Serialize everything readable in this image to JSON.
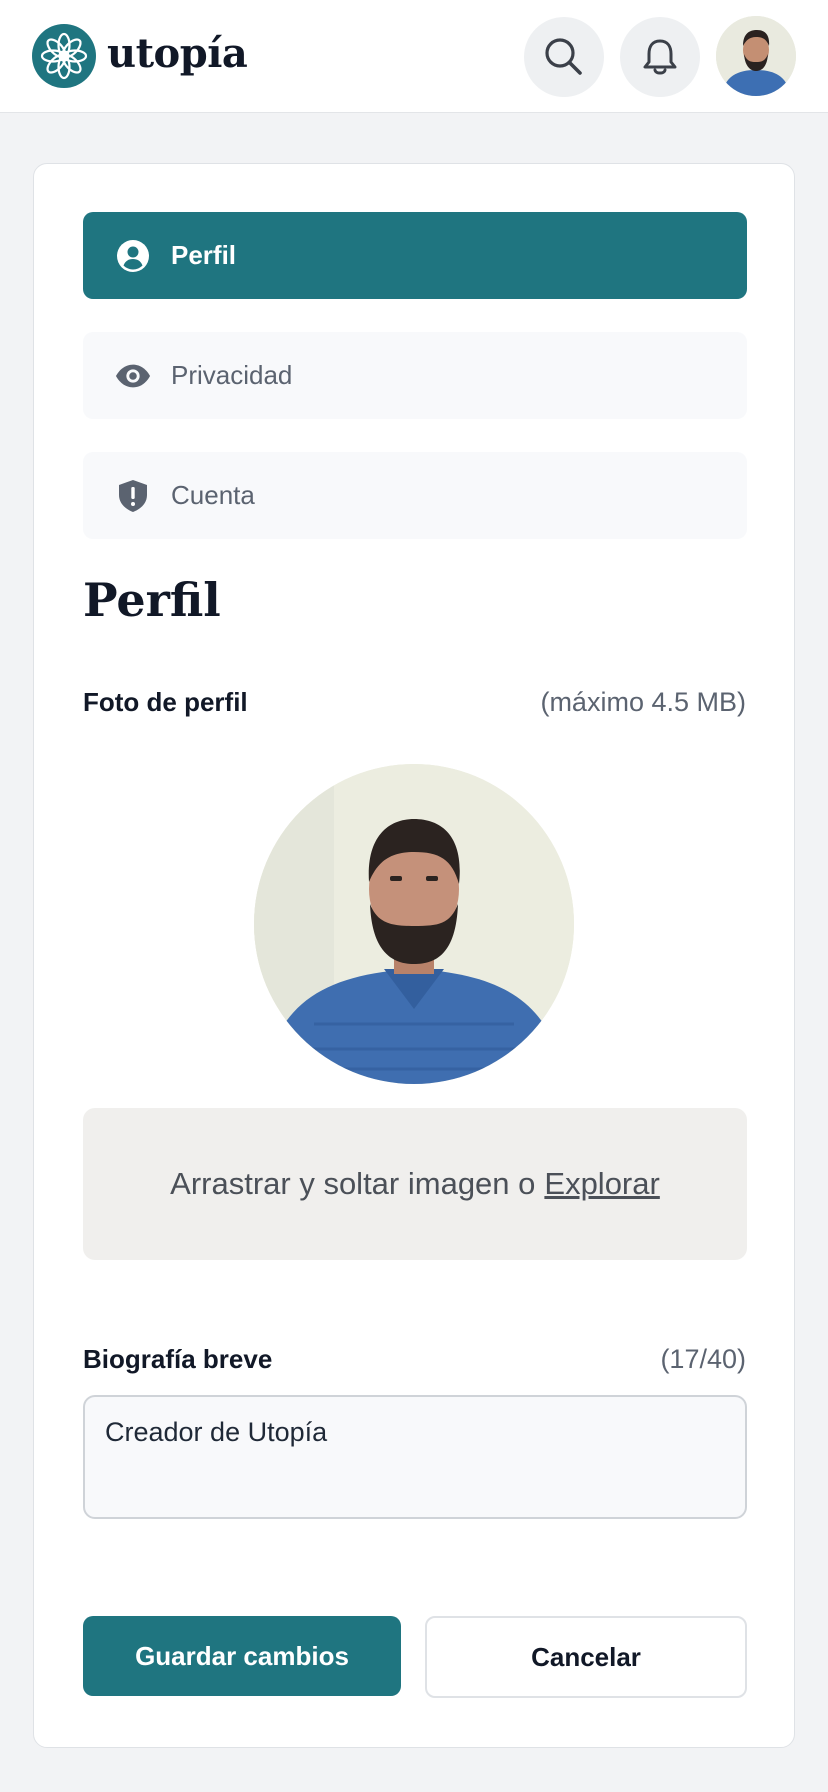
{
  "header": {
    "brand": "utopía",
    "search_icon": "search-icon",
    "notifications_icon": "bell-icon",
    "avatar_alt": "avatar"
  },
  "nav": {
    "items": [
      {
        "label": "Perfil",
        "icon": "user-circle-icon",
        "active": true
      },
      {
        "label": "Privacidad",
        "icon": "eye-icon",
        "active": false
      },
      {
        "label": "Cuenta",
        "icon": "shield-alert-icon",
        "active": false
      }
    ]
  },
  "profile": {
    "title": "Perfil",
    "photo_label": "Foto de perfil",
    "photo_hint": "(máximo 4.5 MB)",
    "dropzone_text": "Arrastrar y soltar imagen o",
    "dropzone_link": "Explorar",
    "bio_label": "Biografía breve",
    "bio_counter": "(17/40)",
    "bio_value": "Creador de Utopía"
  },
  "actions": {
    "save_label": "Guardar cambios",
    "cancel_label": "Cancelar"
  },
  "colors": {
    "brand": "#1f7580",
    "background": "#f2f3f5",
    "surface": "#ffffff",
    "muted_text": "#5b6370"
  }
}
